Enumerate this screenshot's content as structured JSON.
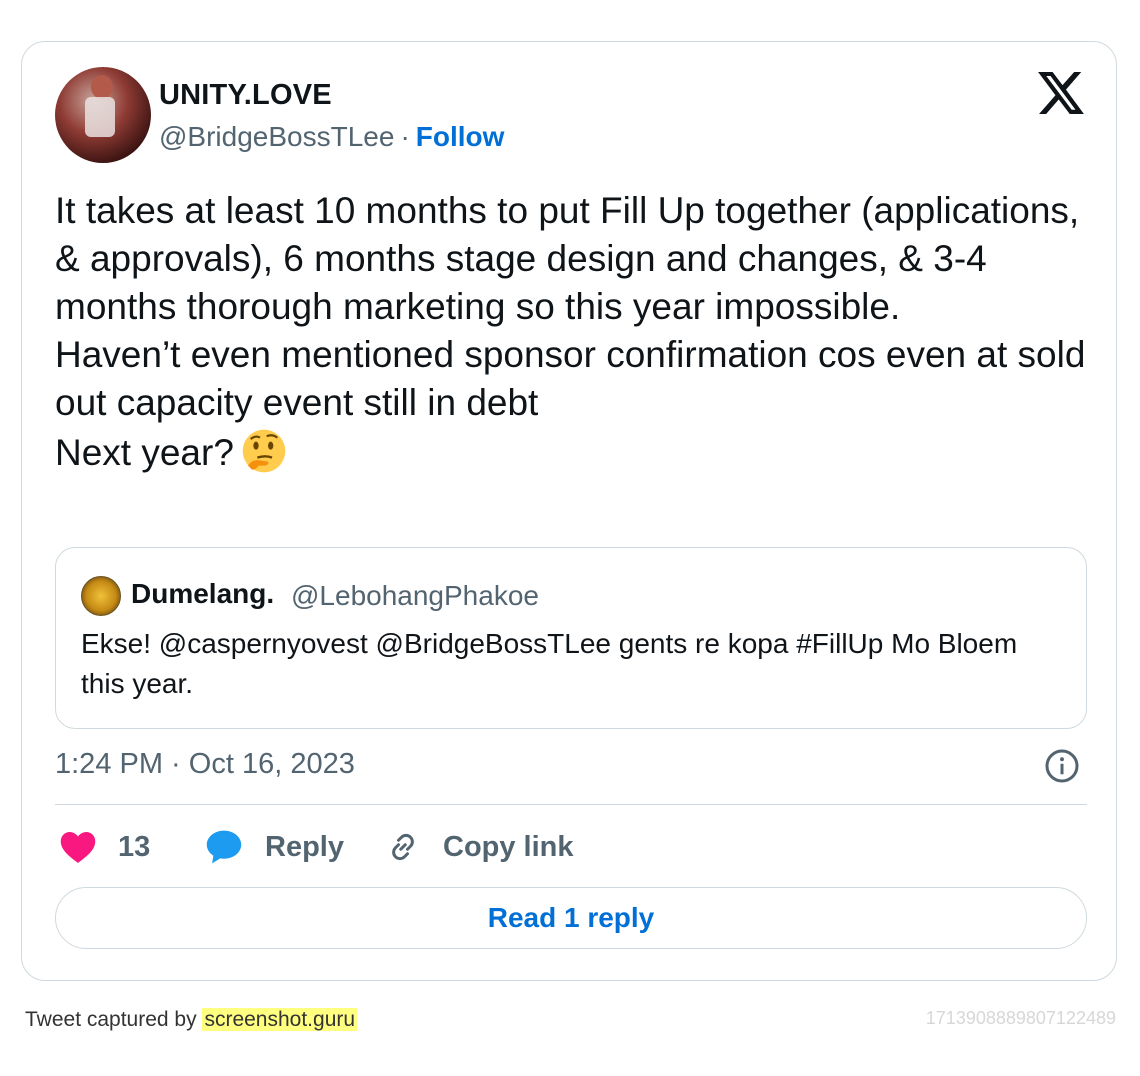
{
  "author": {
    "display_name": "UNITY.LOVE",
    "handle": "@BridgeBossTLee",
    "separator": "·",
    "follow_label": "Follow"
  },
  "tweet": {
    "text": "It takes at least 10 months to put Fill Up together (applications, & approvals), 6 months stage design and changes, & 3-4 months thorough marketing so this year impossible.\nHaven’t even mentioned sponsor confirmation cos even at sold out capacity event still in debt\nNext year?",
    "emoji": "thinking-face",
    "timestamp": "1:24 PM · Oct 16, 2023"
  },
  "quoted_tweet": {
    "display_name": "Dumelang.",
    "handle": "@LebohangPhakoe",
    "text": "Ekse! @caspernyovest @BridgeBossTLee gents re kopa #FillUp Mo Bloem this year."
  },
  "actions": {
    "like_count": "13",
    "reply_label": "Reply",
    "copy_link_label": "Copy link",
    "read_replies_label": "Read 1 reply"
  },
  "footer": {
    "captured_by": "Tweet captured by",
    "site": "screenshot.guru",
    "tweet_id": "1713908889807122489"
  },
  "colors": {
    "accent": "#006fd6",
    "like": "#f91880",
    "reply": "#1d9bf0",
    "muted": "#536471",
    "border": "#cfd9de"
  },
  "icons": [
    "x-logo-icon",
    "info-icon",
    "heart-icon",
    "speech-bubble-icon",
    "link-icon",
    "thinking-face-icon"
  ]
}
